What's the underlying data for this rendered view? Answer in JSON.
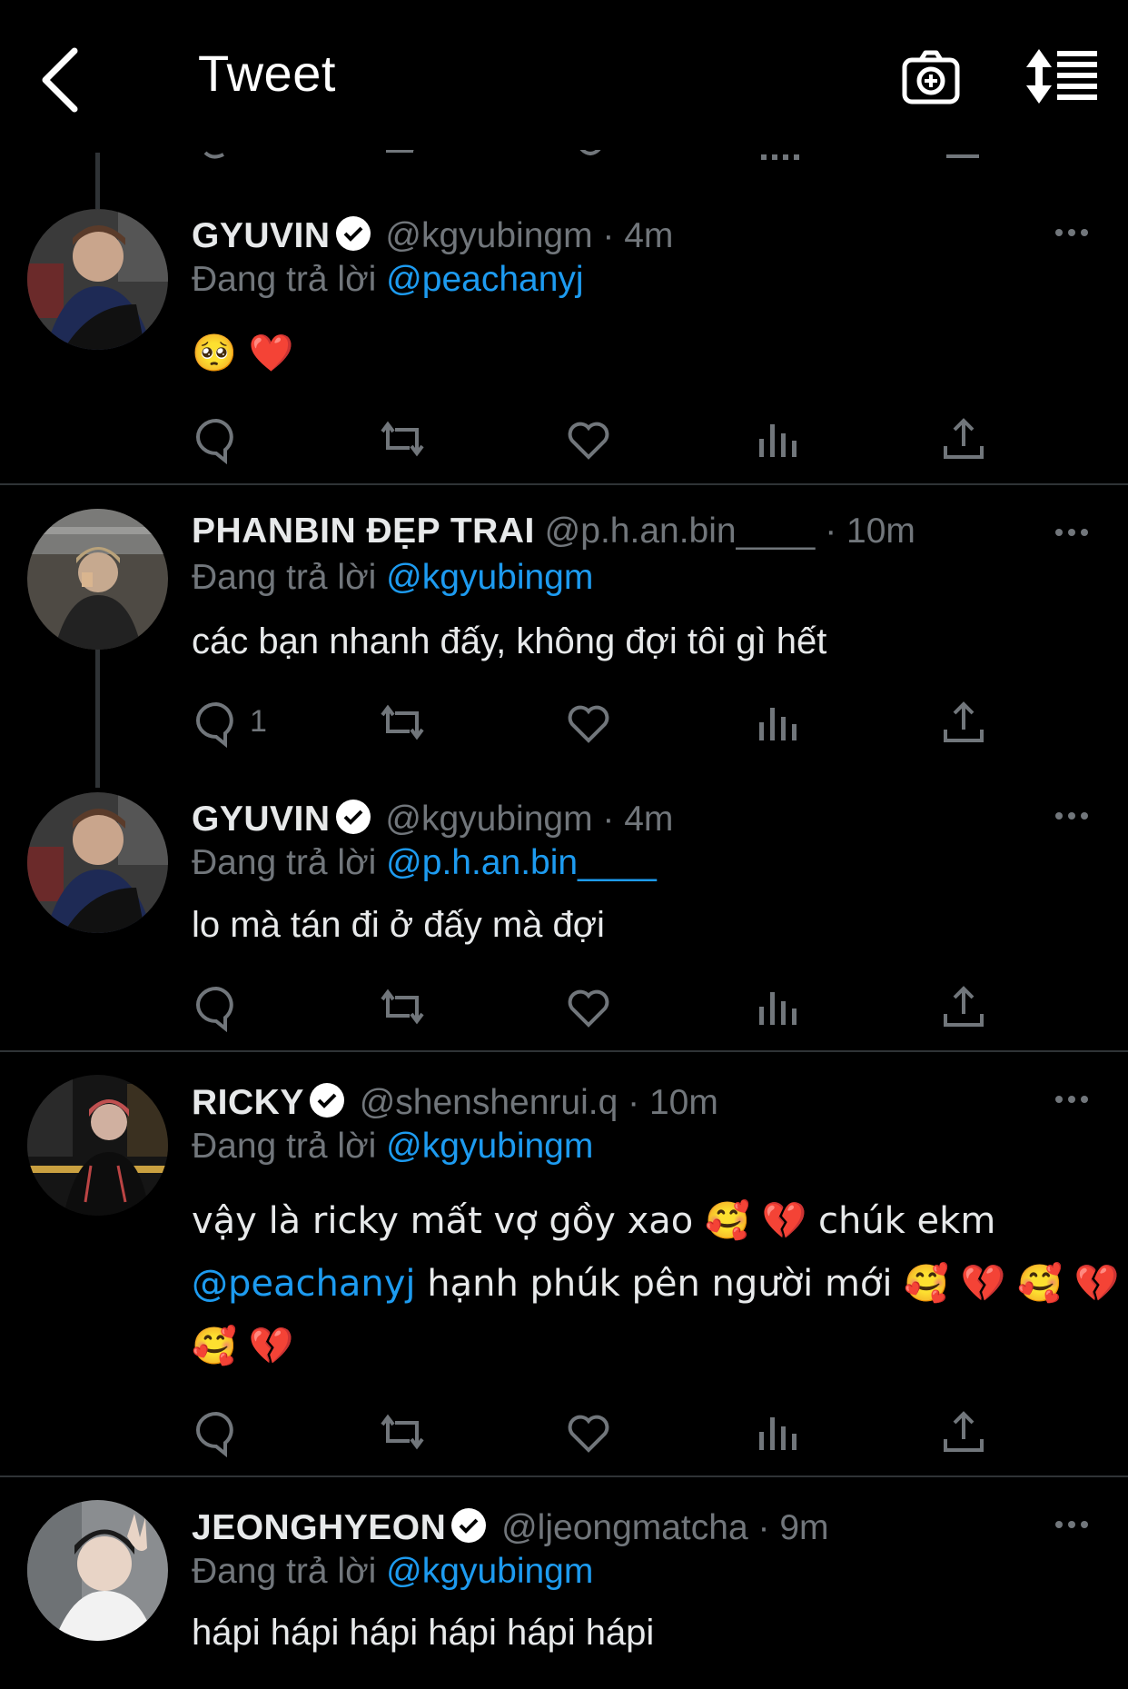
{
  "header": {
    "title": "Tweet"
  },
  "replying_prefix": "Đang trả lời",
  "tweets": [
    {
      "name": "GYUVIN",
      "verified": true,
      "handle": "@kgyubingm",
      "time": "· 4m",
      "reply_to": "@peachanyj",
      "text": "🥺 ❤️",
      "reply_count": ""
    },
    {
      "name": "PHANBIN ĐẸP TRAI",
      "verified": false,
      "handle": "@p.h.an.bin____",
      "time": "· 10m",
      "reply_to": "@kgyubingm",
      "text": "các bạn nhanh đấy, không đợi tôi gì hết",
      "reply_count": "1"
    },
    {
      "name": "GYUVIN",
      "verified": true,
      "handle": "@kgyubingm",
      "time": "· 4m",
      "reply_to": "@p.h.an.bin____",
      "text": "lo mà tán đi ở đấy mà đợi",
      "reply_count": ""
    },
    {
      "name": "RICKY",
      "verified": true,
      "handle": "@shenshenrui.q",
      "time": "· 10m",
      "reply_to": "@kgyubingm",
      "text_line1": "vậy là ricky mất vợ gồy xao 🥰 💔  chúk ekm",
      "text_line2_mention": "@peachanyj",
      "text_line2": " hạnh phúk pên người mới 🥰 💔 🥰 💔",
      "text_line3": "🥰 💔",
      "reply_count": ""
    },
    {
      "name": "JEONGHYEON",
      "verified": true,
      "handle": "@ljeongmatcha",
      "time": "· 9m",
      "reply_to": "@kgyubingm",
      "text": "hápi hápi hápi hápi hápi hápi",
      "reply_count": ""
    }
  ],
  "colors": {
    "background": "#000000",
    "text": "#e7e9ea",
    "secondary": "#71767b",
    "accent": "#1d9bf0",
    "divider": "#2f3336"
  }
}
